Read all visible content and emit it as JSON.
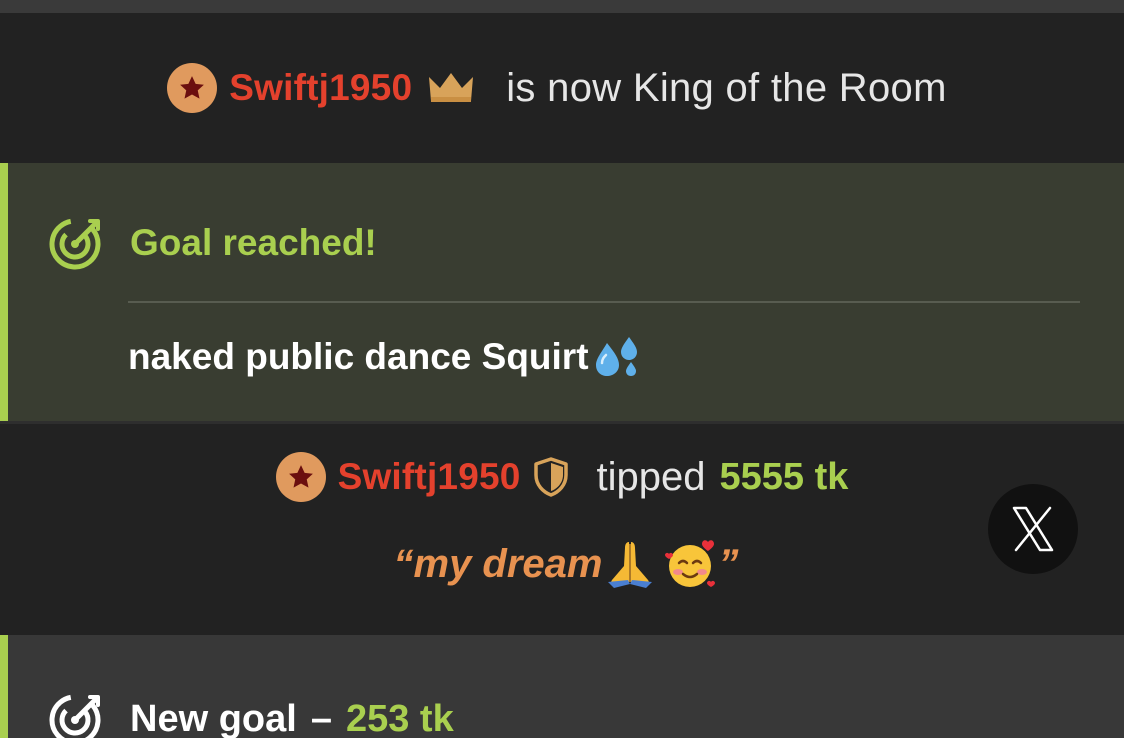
{
  "colors": {
    "background": "#222222",
    "goal_panel": "#393d31",
    "accent_green": "#a9cf4f",
    "username_red": "#e4412d",
    "badge_orange": "#e09a5e",
    "quote_orange": "#e89250",
    "gold": "#d8a35a"
  },
  "king_event": {
    "username": "Swiftj1950",
    "badge_icon": "star-badge-icon",
    "crown_icon": "crown-icon",
    "message": "is now King of the Room"
  },
  "goal_reached": {
    "icon": "target-icon",
    "title": "Goal reached!",
    "goal_name": "naked public dance Squirt",
    "goal_emoji": "sweat-droplets-icon"
  },
  "tip_event": {
    "username": "Swiftj1950",
    "badge_icon": "star-badge-icon",
    "shield_icon": "shield-icon",
    "action": "tipped",
    "amount": "5555 tk",
    "message": "“my dream",
    "message_close": "”",
    "message_emojis": [
      "folded-hands-icon",
      "smiling-face-with-hearts-icon"
    ]
  },
  "close_button": {
    "icon": "x-close-icon"
  },
  "new_goal": {
    "icon": "target-icon",
    "label": "New goal",
    "dash": "–",
    "amount": "253 tk"
  }
}
